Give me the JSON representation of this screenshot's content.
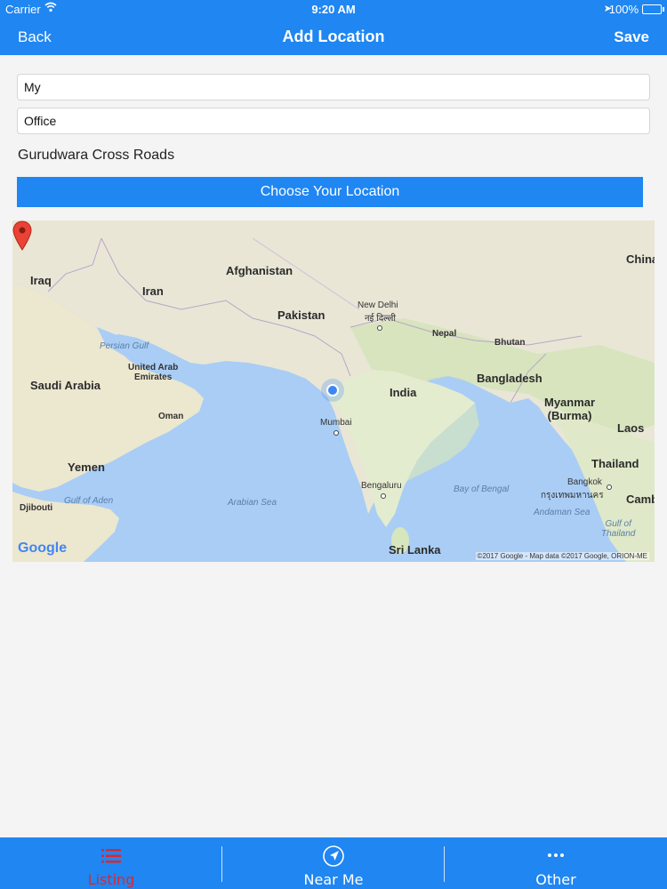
{
  "status_bar": {
    "carrier": "Carrier",
    "time": "9:20 AM",
    "battery": "100%"
  },
  "nav": {
    "back_label": "Back",
    "title": "Add Location",
    "save_label": "Save"
  },
  "form": {
    "field1_value": "My",
    "field2_value": "Office",
    "address": "Gurudwara Cross Roads",
    "choose_button": "Choose Your Location"
  },
  "map": {
    "labels": {
      "iraq": "Iraq",
      "iran": "Iran",
      "afghanistan": "Afghanistan",
      "pakistan": "Pakistan",
      "new_delhi": "New Delhi",
      "new_delhi_hindi": "नई दिल्ली",
      "nepal": "Nepal",
      "bhutan": "Bhutan",
      "china": "China",
      "persian_gulf": "Persian Gulf",
      "uae": "United Arab\nEmirates",
      "saudi_arabia": "Saudi Arabia",
      "oman": "Oman",
      "india": "India",
      "bangladesh": "Bangladesh",
      "myanmar": "Myanmar\n(Burma)",
      "laos": "Laos",
      "mumbai": "Mumbai",
      "yemen": "Yemen",
      "gulf_of_aden": "Gulf of Aden",
      "djibouti": "Djibouti",
      "arabian_sea": "Arabian Sea",
      "bengaluru": "Bengaluru",
      "bay_of_bengal": "Bay of Bengal",
      "thailand": "Thailand",
      "bangkok": "Bangkok",
      "bangkok_thai": "กรุงเทพมหานคร",
      "andaman_sea": "Andaman Sea",
      "gulf_of_thailand": "Gulf of\nThailand",
      "cambodia": "Camb",
      "sri_lanka": "Sri Lanka"
    },
    "logo": "Google",
    "copyright": "©2017 Google - Map data ©2017 Google, ORION-ME"
  },
  "tabs": [
    {
      "label": "Listing",
      "color": "#e0262b"
    },
    {
      "label": "Near Me",
      "color": "#ffffff"
    },
    {
      "label": "Other",
      "color": "#ffffff"
    }
  ],
  "colors": {
    "primary": "#1f86f2",
    "active_tab": "#e0262b"
  }
}
